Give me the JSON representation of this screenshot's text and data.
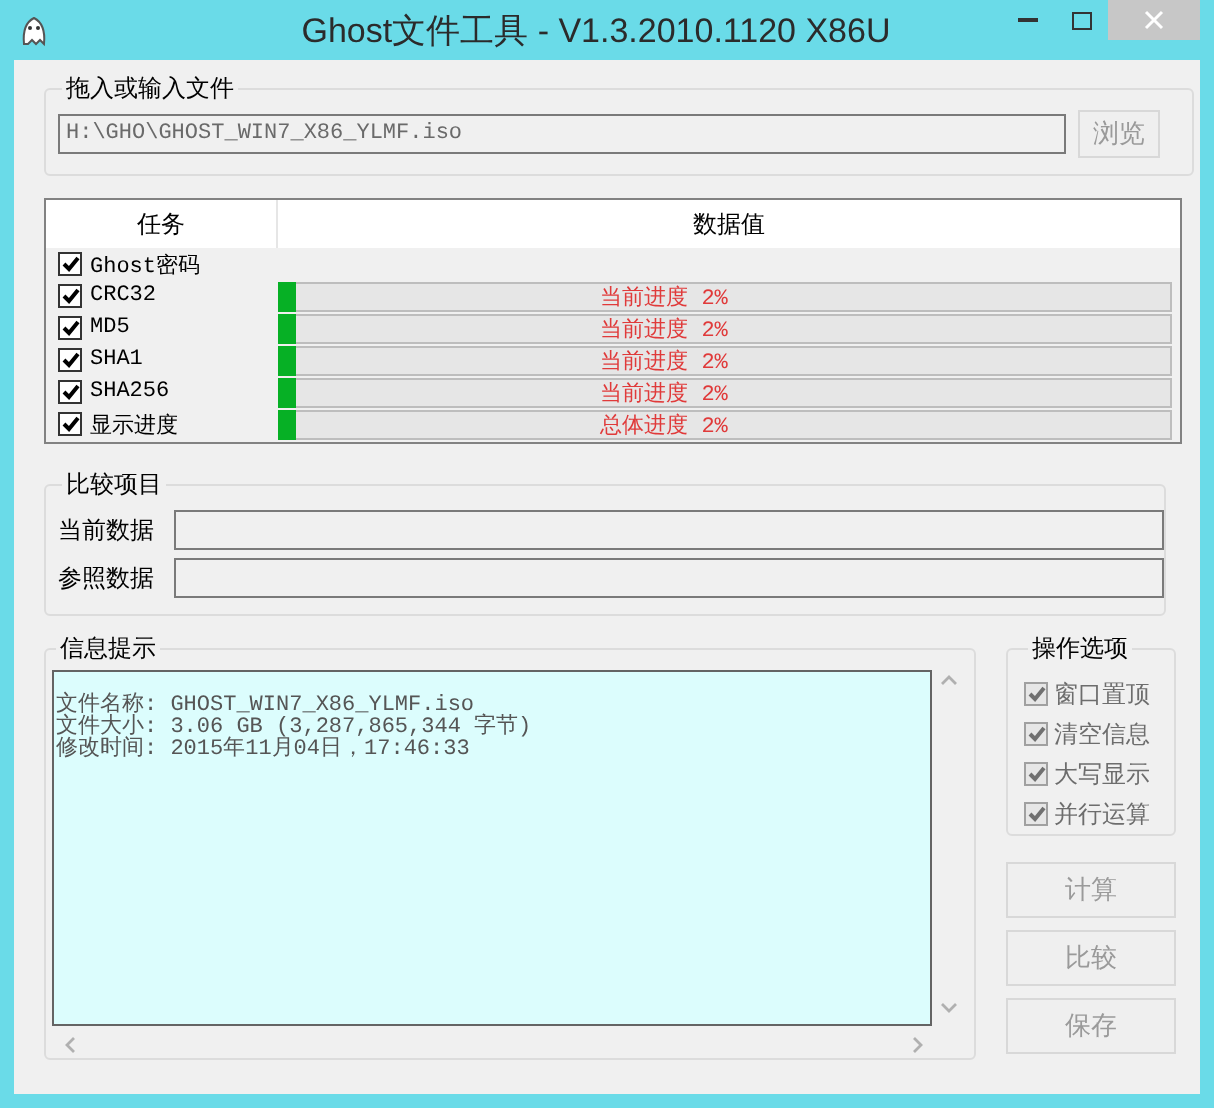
{
  "window": {
    "title": "Ghost文件工具 - V1.3.2010.1120 X86U"
  },
  "file_group": {
    "legend": "拖入或输入文件",
    "path": "H:\\GHO\\GHOST_WIN7_X86_YLMF.iso",
    "browse": "浏览"
  },
  "table": {
    "columns": [
      "任务",
      "数据值"
    ],
    "rows": [
      {
        "label": "Ghost密码",
        "checked": true,
        "kind": "plain"
      },
      {
        "label": "CRC32",
        "checked": true,
        "kind": "progress",
        "level": 0.02,
        "reading": "当前进度 2%"
      },
      {
        "label": "MD5",
        "checked": true,
        "kind": "progress",
        "level": 0.02,
        "reading": "当前进度 2%"
      },
      {
        "label": "SHA1",
        "checked": true,
        "kind": "progress",
        "level": 0.02,
        "reading": "当前进度 2%"
      },
      {
        "label": "SHA256",
        "checked": true,
        "kind": "progress",
        "level": 0.02,
        "reading": "当前进度 2%"
      },
      {
        "label": "显示进度",
        "checked": true,
        "kind": "progress",
        "level": 0.02,
        "reading": "总体进度 2%"
      }
    ]
  },
  "compare": {
    "legend": "比较项目",
    "fields": [
      {
        "label": "当前数据"
      },
      {
        "label": "参照数据"
      }
    ]
  },
  "info": {
    "legend": "信息提示",
    "lines": [
      "文件名称: GHOST_WIN7_X86_YLMF.iso",
      "文件大小: 3.06 GB (3,287,865,344 字节)",
      "修改时间: 2015年11月04日，17:46:33"
    ]
  },
  "options": {
    "legend": "操作选项",
    "items": [
      {
        "label": "窗口置顶",
        "checked": true,
        "disabled": true
      },
      {
        "label": "清空信息",
        "checked": true,
        "disabled": true
      },
      {
        "label": "大写显示",
        "checked": true,
        "disabled": true
      },
      {
        "label": "并行运算",
        "checked": true,
        "disabled": true
      }
    ]
  },
  "buttons": [
    {
      "label": "计算",
      "disabled": true
    },
    {
      "label": "比较",
      "disabled": true
    },
    {
      "label": "保存",
      "disabled": true
    }
  ]
}
